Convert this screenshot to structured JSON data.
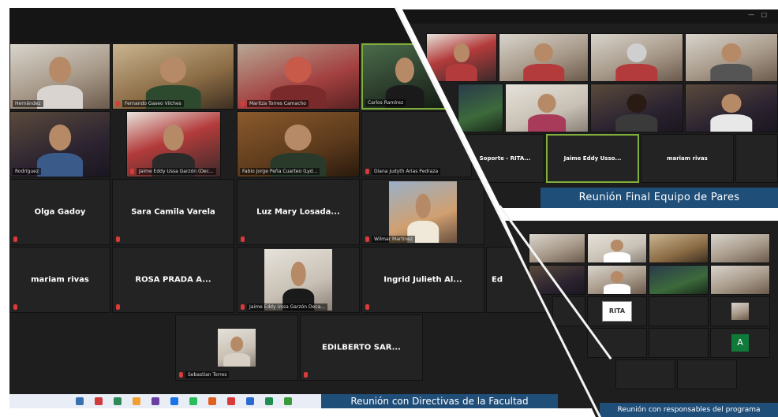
{
  "main_meeting": {
    "banner": "Reunión con Directivas de la Facultad",
    "video_tiles": [
      {
        "caption": "Hernández",
        "style": "v1"
      },
      {
        "caption": "Fernando Gaseo Vilches",
        "style": "v2"
      },
      {
        "caption": "Maritza Torres Camacho",
        "style": "v3"
      },
      {
        "caption": "Carlos Ramírez",
        "style": "v4",
        "active": true
      },
      {
        "caption": "Rodríguez",
        "style": "v5"
      },
      {
        "caption": "Jaime Eddy Ussa Garzón (Dec...",
        "style": "v6"
      },
      {
        "caption": "Fabio Jorge Peña Cuarteo (Lyd...",
        "style": "v7"
      },
      {
        "caption": "Diana Judyth Arias Pedraza",
        "style": "v4"
      },
      {
        "caption": "Wilmar Martínez",
        "style": "v9"
      },
      {
        "caption": "Jaime Eddy Ussa Garzón Deca...",
        "style": "v8"
      },
      {
        "caption": "Sebastian Torres",
        "style": "v8"
      }
    ],
    "name_tiles": [
      "Olga Gadoy",
      "Sara Camila Varela",
      "Luz Mary Losada...",
      "mariam rivas",
      "ROSA PRADA A...",
      "Ingrid Julieth Al...",
      "Ed",
      "EDILBERTO SAR..."
    ]
  },
  "top_right_meeting": {
    "banner": "Reunión Final Equipo de Pares",
    "name_tiles": [
      "Soporte - RITA...",
      "Jaime Eddy Usso...",
      "mariam rivas"
    ]
  },
  "bottom_right_meeting": {
    "banner": "Reunión con responsables del programa",
    "logo_text": "RITA",
    "avatar_letter": "A"
  },
  "taskbar": {
    "icon_colors": [
      "#3a6fb0",
      "#d13a3a",
      "#2e8b57",
      "#f0a030",
      "#6a3fa0",
      "#1a73e8",
      "#2bbd5a",
      "#e06020",
      "#d93a3a",
      "#2a6bd0",
      "#1f8f4f",
      "#3a9a3a"
    ]
  },
  "colors": {
    "banner_blue": "#1f4e79",
    "active_speaker": "#7fae3a",
    "tile_bg": "#232323"
  }
}
